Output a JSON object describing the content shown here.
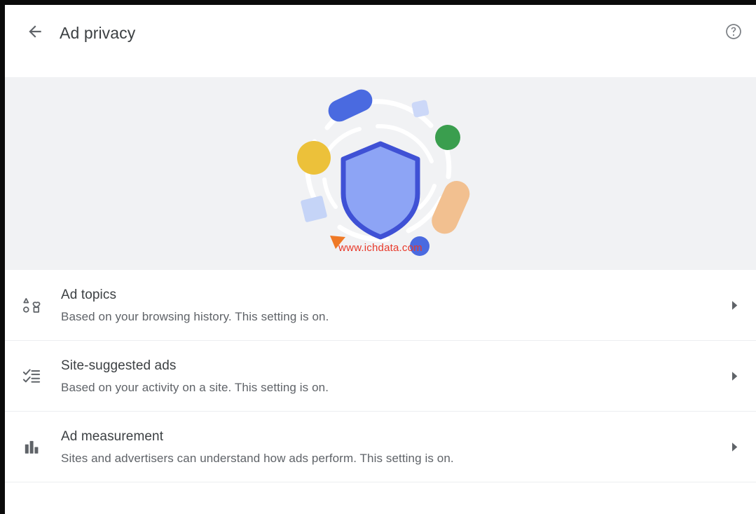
{
  "header": {
    "title": "Ad privacy",
    "back_icon": "arrow-left-icon",
    "help_icon": "help-circle-icon"
  },
  "hero": {
    "illustration_name": "ad-privacy-shield-illustration",
    "shield_icon": "shield-icon",
    "watermark": "www.ichdata.com",
    "colors": {
      "background": "#f1f2f4",
      "shield_fill": "#8da4f5",
      "shield_stroke": "#3f51d5",
      "orbit": "#ffffff",
      "blue_pill": "#4a6ae0",
      "blue_dot": "#4a6ae0",
      "yellow_dot": "#ecc13a",
      "green_dot": "#3a9e4e",
      "peach_pill": "#f2c090",
      "orange_triangle": "#ef7926",
      "light_blue_square": "#c5d4f7",
      "watermark_text": "#e8392a"
    },
    "shapes": [
      {
        "name": "blue-pill",
        "color": "#4a6ae0"
      },
      {
        "name": "light-blue-square-top",
        "color": "#ccd8f8"
      },
      {
        "name": "green-circle",
        "color": "#3a9e4e"
      },
      {
        "name": "peach-pill",
        "color": "#f2c090"
      },
      {
        "name": "blue-circle",
        "color": "#4a6ae0"
      },
      {
        "name": "orange-triangle",
        "color": "#ef7926"
      },
      {
        "name": "light-blue-square-left",
        "color": "#c5d4f7"
      },
      {
        "name": "yellow-circle",
        "color": "#ecc13a"
      }
    ]
  },
  "settings": {
    "rows": [
      {
        "id": "ad-topics",
        "icon": "shapes-grid-icon",
        "title": "Ad topics",
        "description": "Based on your browsing history. This setting is on.",
        "chevron": "chevron-right-icon"
      },
      {
        "id": "site-suggested-ads",
        "icon": "checklist-icon",
        "title": "Site-suggested ads",
        "description": "Based on your activity on a site. This setting is on.",
        "chevron": "chevron-right-icon"
      },
      {
        "id": "ad-measurement",
        "icon": "bar-chart-icon",
        "title": "Ad measurement",
        "description": "Sites and advertisers can understand how ads perform. This setting is on.",
        "chevron": "chevron-right-icon"
      }
    ]
  }
}
